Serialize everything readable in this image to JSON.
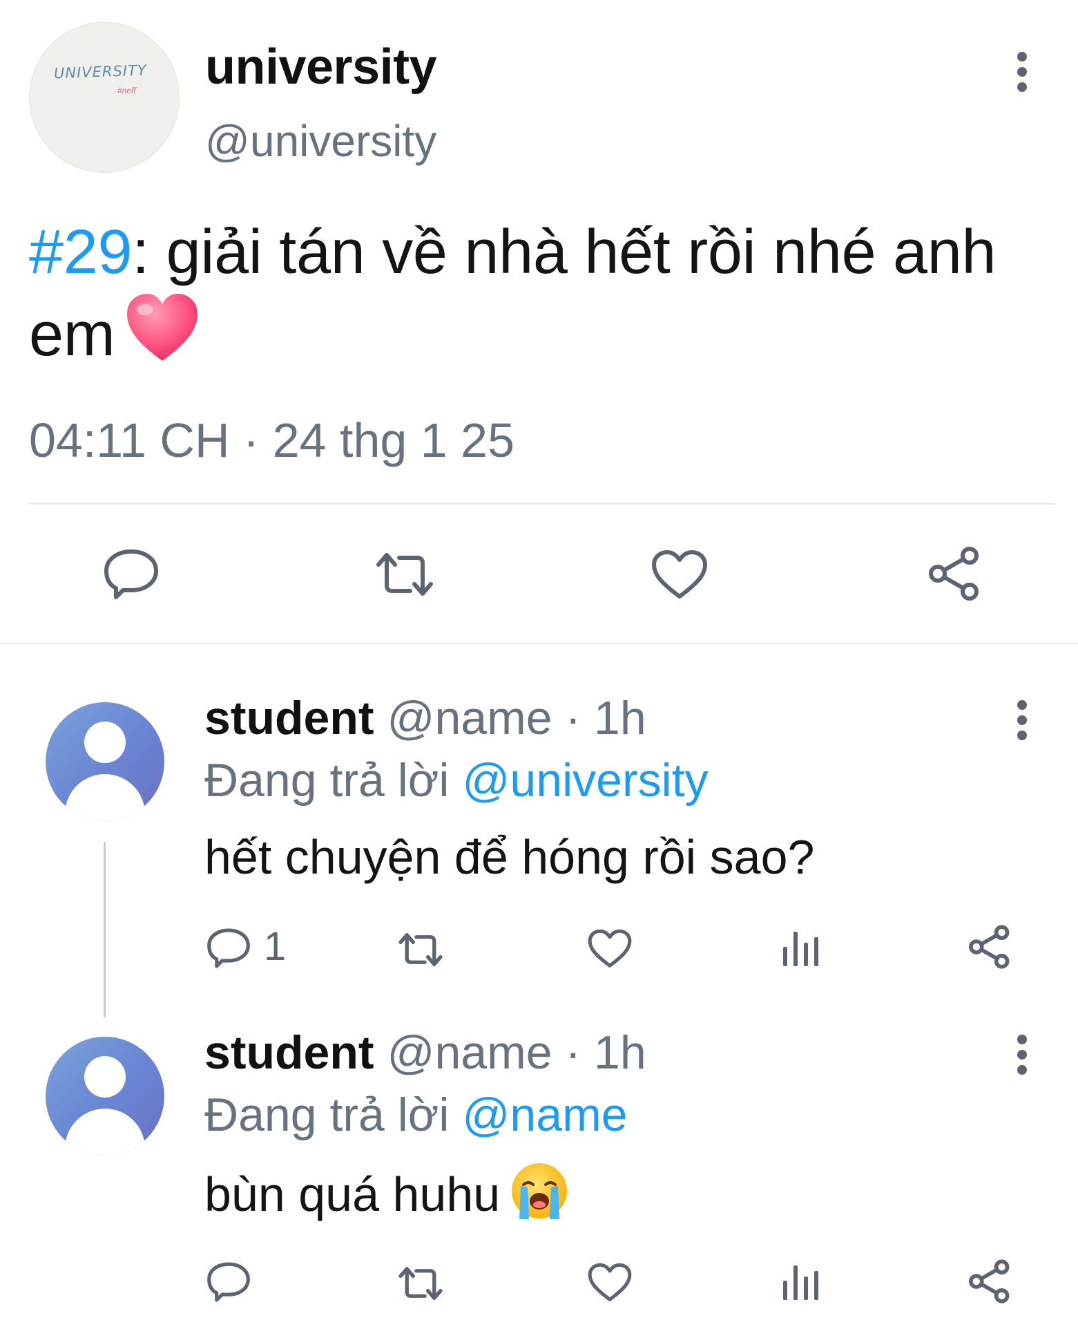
{
  "main_tweet": {
    "avatar_logo_text": "UNIVERSITY",
    "avatar_logo_sub": "#neff",
    "display_name": "university",
    "handle": "@university",
    "hashtag": "#29",
    "text": ": giải tán về nhà hết rồi nhé anh em",
    "emoji": "heart-emoji",
    "timestamp": "04:11 CH · 24 thg 1 25",
    "actions": [
      "reply-icon",
      "retweet-icon",
      "like-icon",
      "share-icon"
    ]
  },
  "replies": [
    {
      "display_name": "student",
      "handle_time": "@name · 1h",
      "replying_prefix": "Đang trả lời ",
      "replying_to": "@university",
      "text": "hết chuyện để hóng rồi sao?",
      "reply_count": "1",
      "actions": [
        "reply-icon",
        "retweet-icon",
        "like-icon",
        "views-icon",
        "share-icon"
      ]
    },
    {
      "display_name": "student",
      "handle_time": "@name · 1h",
      "replying_prefix": "Đang trả lời ",
      "replying_to": "@name",
      "text": "bùn quá huhu",
      "emoji": "crying-face-emoji",
      "actions": [
        "reply-icon",
        "retweet-icon",
        "like-icon",
        "views-icon",
        "share-icon"
      ]
    }
  ],
  "colors": {
    "link": "#1d9bf0",
    "secondary_text": "#66727d",
    "icon": "#5b6470"
  }
}
